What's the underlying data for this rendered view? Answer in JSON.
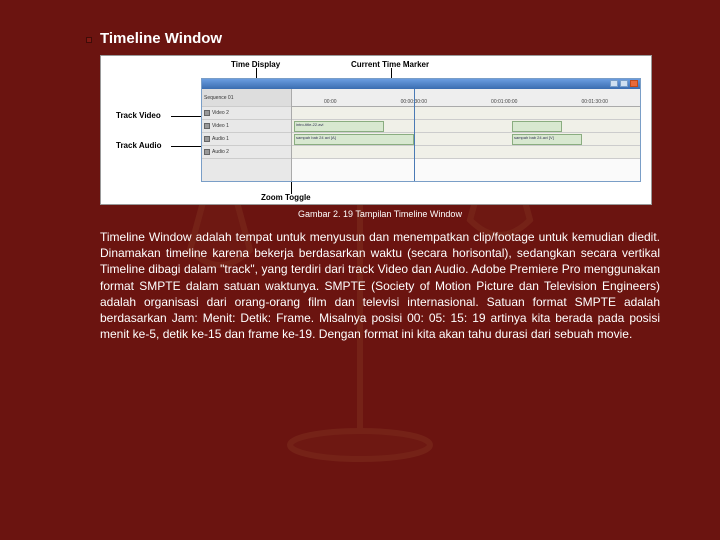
{
  "title": "Timeline Window",
  "figure": {
    "label_time_display": "Time Display",
    "label_current_marker": "Current Time Marker",
    "label_track_video": "Track Video",
    "label_track_audio": "Track Audio",
    "label_zoom_toggle": "Zoom Toggle",
    "timeline": {
      "ruler_ticks": [
        "00:00",
        "00:00:30:00",
        "00:01:00:00",
        "00:01:30:00"
      ],
      "left_rows": [
        "Sequence 01",
        "Video 2",
        "Video 1",
        "Audio 1",
        "Audio 2"
      ],
      "clips": {
        "v1a": "intro-title-22.avi",
        "v1b": "",
        "a1a": "sampah bab 24 avi [A]",
        "a1b": "sampah bab 24.avi [V]"
      }
    }
  },
  "caption": "Gambar 2. 19 Tampilan Timeline Window",
  "body": "Timeline Window adalah tempat untuk menyusun dan menempatkan clip/footage untuk kemudian diedit. Dinamakan timeline karena bekerja berdasarkan waktu (secara horisontal), sedangkan secara vertikal Timeline dibagi dalam \"track\", yang terdiri dari track Video dan Audio. Adobe Premiere Pro menggunakan format SMPTE dalam satuan waktunya. SMPTE (Society of Motion Picture dan Television Engineers) adalah organisasi dari orang-orang film dan televisi internasional. Satuan format SMPTE adalah berdasarkan Jam: Menit: Detik: Frame. Misalnya posisi 00: 05: 15: 19 artinya kita berada pada posisi menit ke-5, detik ke-15 dan frame ke-19. Dengan format ini kita akan tahu durasi dari sebuah movie."
}
